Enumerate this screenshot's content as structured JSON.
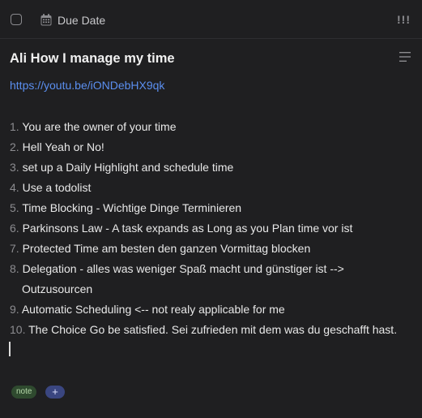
{
  "toolbar": {
    "due_date_label": "Due Date",
    "priority_label": "!!!"
  },
  "task": {
    "title": "Ali How I manage my time",
    "link": "https://youtu.be/iONDebHX9qk",
    "items": [
      {
        "num": "1.",
        "text": "You are the owner of your time"
      },
      {
        "num": "2.",
        "text": "Hell Yeah or No!"
      },
      {
        "num": "3.",
        "text": "set up a Daily Highlight and schedule time"
      },
      {
        "num": "4.",
        "text": "Use a todolist"
      },
      {
        "num": "5.",
        "text": "Time Blocking - Wichtige Dinge Terminieren"
      },
      {
        "num": "6.",
        "text": "Parkinsons Law - A task expands as Long as you Plan time vor ist"
      },
      {
        "num": "7.",
        "text": "Protected Time am besten den ganzen Vormittag blocken"
      },
      {
        "num": "8.",
        "text": "Delegation - alles was weniger Spaß macht und günstiger ist  -->",
        "cont": "Outzusourcen"
      },
      {
        "num": "9.",
        "text": "Automatic Scheduling <-- not realy applicable for me"
      },
      {
        "num": "10.",
        "text": "The Choice Go be satisfied. Sei zufrieden mit dem was du geschafft hast."
      }
    ]
  },
  "tags": {
    "note": "note",
    "add": "+"
  },
  "colors": {
    "background": "#1f1f21",
    "link": "#5b8ff0",
    "tag_bg": "#2f4a2f",
    "add_bg": "#3a4680"
  }
}
